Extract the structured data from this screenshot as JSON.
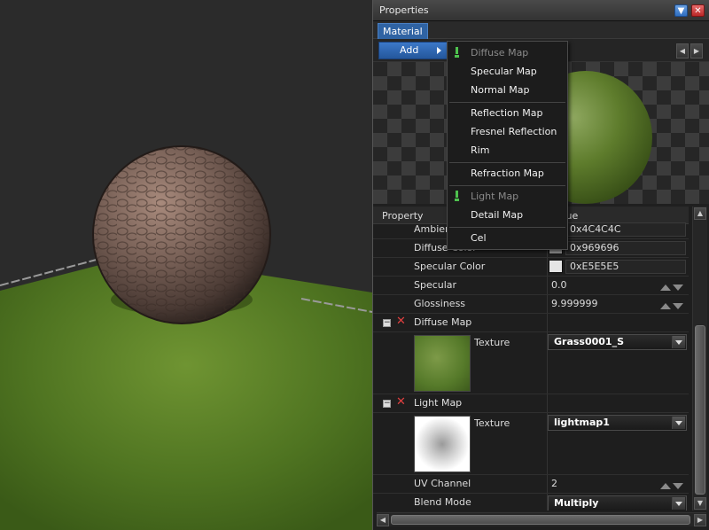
{
  "window": {
    "title": "Properties",
    "menu_icon": "chevron-down-icon",
    "close_icon": "close-icon"
  },
  "tabs": [
    {
      "label": "Material",
      "active": true
    }
  ],
  "toolbar": {
    "add_label": "Add"
  },
  "popup_menu": {
    "items": [
      {
        "label": "Diffuse Map",
        "checked": true,
        "disabled": true
      },
      {
        "label": "Specular Map",
        "checked": false,
        "disabled": false
      },
      {
        "label": "Normal Map",
        "checked": false,
        "disabled": false
      },
      {
        "label": "Reflection Map",
        "checked": false,
        "disabled": false
      },
      {
        "label": "Fresnel Reflection",
        "checked": false,
        "disabled": false
      },
      {
        "label": "Rim",
        "checked": false,
        "disabled": false
      },
      {
        "label": "Refraction Map",
        "checked": false,
        "disabled": false
      },
      {
        "label": "Light Map",
        "checked": true,
        "disabled": true
      },
      {
        "label": "Detail Map",
        "checked": false,
        "disabled": false
      },
      {
        "label": "Cel",
        "checked": false,
        "disabled": false
      }
    ]
  },
  "grid": {
    "header_property": "Property",
    "header_value": "Value",
    "rows": {
      "ambient": {
        "label": "Ambient Color",
        "value": "0x4C4C4C",
        "color": "#4C4C4C"
      },
      "diffuse": {
        "label": "Diffuse Color",
        "value": "0x969696",
        "color": "#969696"
      },
      "specular_color": {
        "label": "Specular Color",
        "value": "0xE5E5E5",
        "color": "#E5E5E5"
      },
      "specular": {
        "label": "Specular",
        "value": "0.0"
      },
      "glossiness": {
        "label": "Glossiness",
        "value": "9.999999"
      }
    },
    "diffuse_map": {
      "label": "Diffuse Map",
      "texture_label": "Texture",
      "texture_value": "Grass0001_S"
    },
    "light_map": {
      "label": "Light Map",
      "texture_label": "Texture",
      "texture_value": "lightmap1",
      "uv_channel_label": "UV Channel",
      "uv_channel_value": "2",
      "blend_mode_label": "Blend Mode",
      "blend_mode_value": "Multiply"
    }
  },
  "colors": {
    "accent": "#2f63a3",
    "check": "#4ec24e",
    "remove": "#e04040"
  }
}
